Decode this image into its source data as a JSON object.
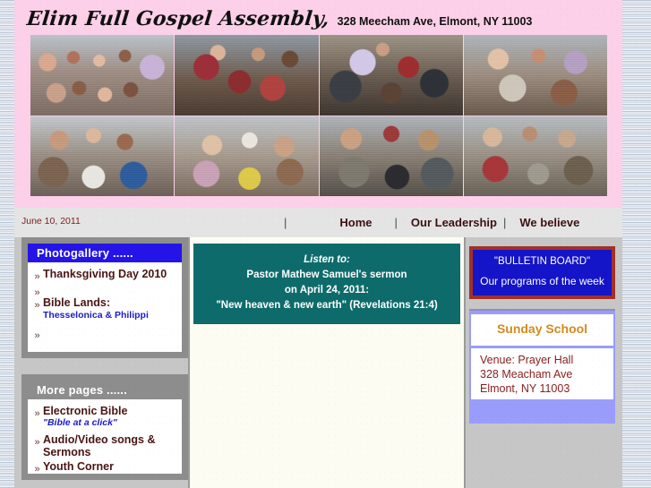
{
  "header": {
    "site_title": "Elim Full Gospel Assembly,",
    "site_address": "328 Meecham Ave, Elmont, NY 11003",
    "background_color": "#fbd0e8",
    "collage_alt": "congregation-photo-collage"
  },
  "nav": {
    "date": "June 10, 2011",
    "separator": "|",
    "links": [
      {
        "label": "Home",
        "name": "nav-link-home"
      },
      {
        "label": "Our Leadership",
        "name": "nav-link-our-leadership"
      },
      {
        "label": "We believe",
        "name": "nav-link-we-believe"
      }
    ]
  },
  "sidebar": {
    "photogallery": {
      "heading": "Photogallery ......",
      "heading_color": "#2414e8",
      "items": [
        {
          "text": "Thanksgiving Day 2010",
          "sub": ""
        },
        {
          "text": "",
          "sub": ""
        },
        {
          "text": "Bible Lands:",
          "sub": "Thesselonica & Philippi"
        },
        {
          "text": "",
          "sub": ""
        }
      ]
    },
    "more_pages": {
      "heading": "More pages ......",
      "heading_color": "#8d8d8d",
      "items": [
        {
          "text": "Electronic Bible",
          "sub": "\"Bible at a click\""
        },
        {
          "text": "Audio/Video songs & Sermons",
          "sub": ""
        },
        {
          "text": "Youth Corner",
          "sub": ""
        }
      ]
    },
    "bullet_glyph": "»"
  },
  "main": {
    "listen_box": {
      "background_color": "#0e6b6b",
      "lines": [
        "Listen to:",
        "Pastor Mathew Samuel's sermon",
        "on April 24, 2011:",
        "\"New heaven & new earth\" (Revelations 21:4)"
      ]
    }
  },
  "right": {
    "bulletin": {
      "title": "\"BULLETIN BOARD\"",
      "subtitle": "Our programs of the week",
      "background_color": "#1414c8",
      "border_color": "#a13028"
    },
    "panel_color": "#9a9cfb",
    "sunday_school": {
      "heading": "Sunday School",
      "heading_color": "#d58a1e",
      "lines": [
        "Venue: Prayer Hall",
        "328 Meacham Ave",
        "Elmont, NY 11003"
      ]
    }
  }
}
